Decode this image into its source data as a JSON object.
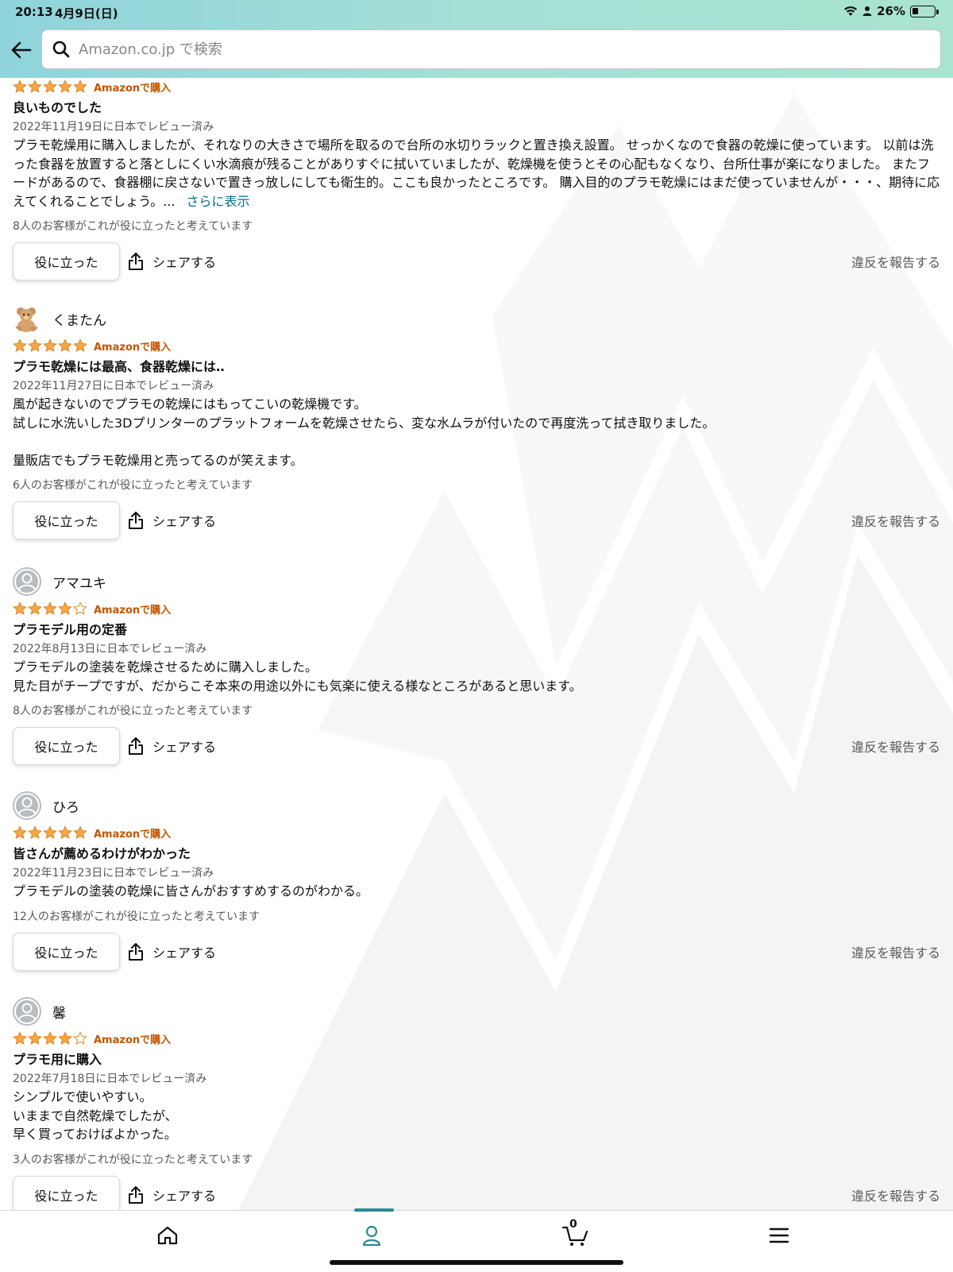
{
  "status_bar": {
    "time": "20:13",
    "date": "4月9日(日)",
    "battery": "26%",
    "battery_level": 0.26
  },
  "search": {
    "placeholder": "Amazon.co.jp で検索"
  },
  "colors": {
    "header_start": "#8fd3dc",
    "header_end": "#a8e4cf",
    "star": "#f3a847",
    "verified": "#c45500",
    "link": "#007185",
    "nav_active": "#2a8a94"
  },
  "icons": {
    "back": "back-arrow-icon",
    "search": "search-icon",
    "share": "share-icon",
    "home": "home-icon",
    "account": "account-icon",
    "cart": "cart-icon",
    "menu": "menu-icon"
  },
  "common": {
    "helpful_button": "役に立った",
    "share_button": "シェアする",
    "report_link": "違反を報告する",
    "more_link": "さらに表示"
  },
  "reviews": [
    {
      "reviewer": "",
      "rating": 5,
      "verified": "Amazonで購入",
      "title": "良いものでした",
      "date": "2022年11月19日に日本でレビュー済み",
      "body": "プラモ乾燥用に購入しましたが、それなりの大きさで場所を取るので台所の水切りラックと置き換え設置。 せっかくなので食器の乾燥に使っています。 以前は洗った食器を放置すると落としにくい水滴痕が残ることがありすぐに拭いていましたが、乾燥機を使うとその心配もなくなり、台所仕事が楽になりました。 またフードがあるので、食器棚に戻さないで置きっ放しにしても衛生的。ここも良かったところです。 購入目的のプラモ乾燥にはまだ使っていませんが・・・、期待に応えてくれることでしょう。...",
      "helpful": "8人のお客様がこれが役に立ったと考えています"
    },
    {
      "reviewer": "くまたん",
      "rating": 5,
      "verified": "Amazonで購入",
      "title": "プラモ乾燥には最高、食器乾燥には‥",
      "date": "2022年11月27日に日本でレビュー済み",
      "body": "風が起きないのでプラモの乾燥にはもってこいの乾燥機です。\n試しに水洗いした3Dプリンターのプラットフォームを乾燥させたら、変な水ムラが付いたので再度洗って拭き取りました。\n\n量販店でもプラモ乾燥用と売ってるのが笑えます。",
      "helpful": "6人のお客様がこれが役に立ったと考えています"
    },
    {
      "reviewer": "アマユキ",
      "rating": 4,
      "verified": "Amazonで購入",
      "title": "プラモデル用の定番",
      "date": "2022年8月13日に日本でレビュー済み",
      "body": "プラモデルの塗装を乾燥させるために購入しました。\n見た目がチープですが、だからこそ本来の用途以外にも気楽に使える様なところがあると思います。",
      "helpful": "8人のお客様がこれが役に立ったと考えています"
    },
    {
      "reviewer": "ひろ",
      "rating": 5,
      "verified": "Amazonで購入",
      "title": "皆さんが薦めるわけがわかった",
      "date": "2022年11月23日に日本でレビュー済み",
      "body": "プラモデルの塗装の乾燥に皆さんがおすすめするのがわかる。",
      "helpful": "12人のお客様がこれが役に立ったと考えています"
    },
    {
      "reviewer": "馨",
      "rating": 4,
      "verified": "Amazonで購入",
      "title": "プラモ用に購入",
      "date": "2022年7月18日に日本でレビュー済み",
      "body": "シンプルで使いやすい。\nいままで自然乾燥でしたが、\n早く買っておけばよかった。",
      "helpful": "3人のお客様がこれが役に立ったと考えています"
    }
  ],
  "bottom_nav": {
    "cart_count": "0",
    "active": "account"
  }
}
